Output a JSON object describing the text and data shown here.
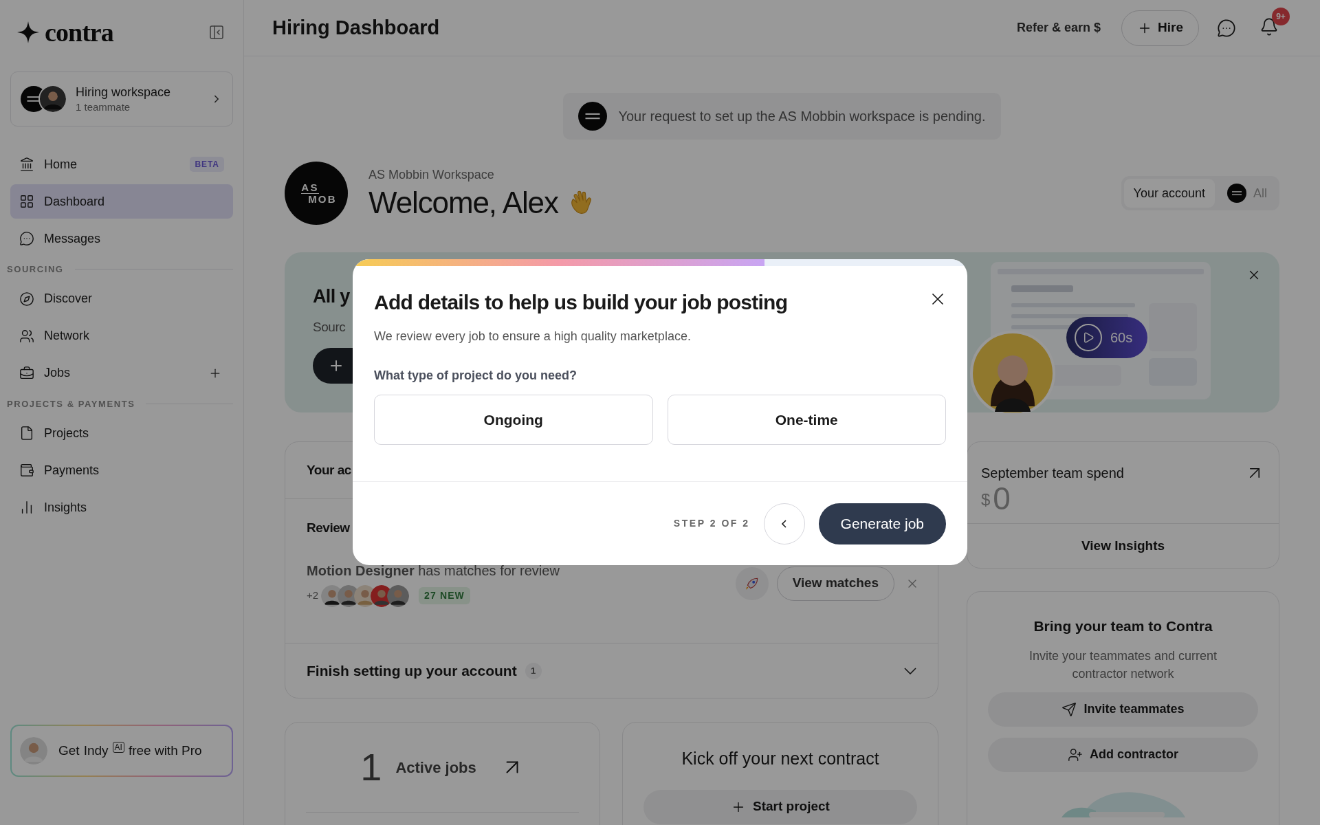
{
  "sidebar": {
    "logo": "contra",
    "workspace": {
      "name": "Hiring workspace",
      "members": "1 teammate"
    },
    "sections": [
      {
        "items": [
          {
            "label": "Home",
            "badge": "BETA",
            "selected": false,
            "add_button": false
          },
          {
            "label": "Dashboard",
            "selected": true,
            "add_button": false
          },
          {
            "label": "Messages",
            "selected": false,
            "add_button": false
          }
        ]
      },
      {
        "heading": "SOURCING",
        "items": [
          {
            "label": "Discover",
            "selected": false,
            "add_button": false
          },
          {
            "label": "Network",
            "selected": false,
            "add_button": false
          },
          {
            "label": "Jobs",
            "selected": false,
            "add_button": true
          }
        ]
      },
      {
        "heading": "PROJECTS & PAYMENTS",
        "items": [
          {
            "label": "Projects",
            "selected": false,
            "add_button": false
          },
          {
            "label": "Payments",
            "selected": false,
            "add_button": false
          },
          {
            "label": "Insights",
            "selected": false,
            "add_button": false
          }
        ]
      }
    ],
    "promo": {
      "lead": "Get",
      "name": "Indy",
      "tag": "AI",
      "rest": "free with Pro"
    }
  },
  "header": {
    "title": "Hiring Dashboard",
    "refer": "Refer & earn $",
    "hire": "Hire",
    "notification_count": "9+"
  },
  "pending_notice": "Your request to set up the AS Mobbin workspace is pending.",
  "welcome": {
    "workspace": "AS Mobbin Workspace",
    "greeting": "Welcome, Alex",
    "logo_text": [
      "AS",
      "MOB"
    ],
    "toggle": [
      {
        "label": "Your account",
        "selected": true
      },
      {
        "label": "All",
        "selected": false
      }
    ]
  },
  "intro_banner": {
    "title": "All y",
    "subtitle": "Sourc",
    "video_length": "60s"
  },
  "action_items": {
    "title": "Your ac",
    "review_heading": "Review",
    "match": {
      "text": "**Motion Designer** has matches for review",
      "extra": "+2",
      "new_badge": "27 NEW",
      "button": "View matches"
    },
    "setup": {
      "label": "Finish setting up your account",
      "count": "1",
      "expanded": false
    }
  },
  "active_jobs": {
    "count": "1",
    "label": "Active jobs"
  },
  "contract": {
    "title": "Kick off your next contract",
    "button": "Start project"
  },
  "spend": {
    "title": "September team spend",
    "currency": "$",
    "amount": "0",
    "link": "View Insights"
  },
  "team": {
    "title": "Bring your team to Contra",
    "description": "Invite your teammates and current contractor network",
    "buttons": [
      "Invite teammates",
      "Add contractor"
    ]
  },
  "modal": {
    "progress": {
      "level": 0.67
    },
    "title": "Add details to help us build your job posting",
    "subtitle": "We review every job to ensure a high quality marketplace.",
    "question": "What type of project do you need?",
    "options": [
      {
        "label": "Ongoing",
        "selected": false
      },
      {
        "label": "One-time",
        "selected": false
      }
    ],
    "step": "STEP 2 OF 2",
    "primary": "Generate job"
  }
}
